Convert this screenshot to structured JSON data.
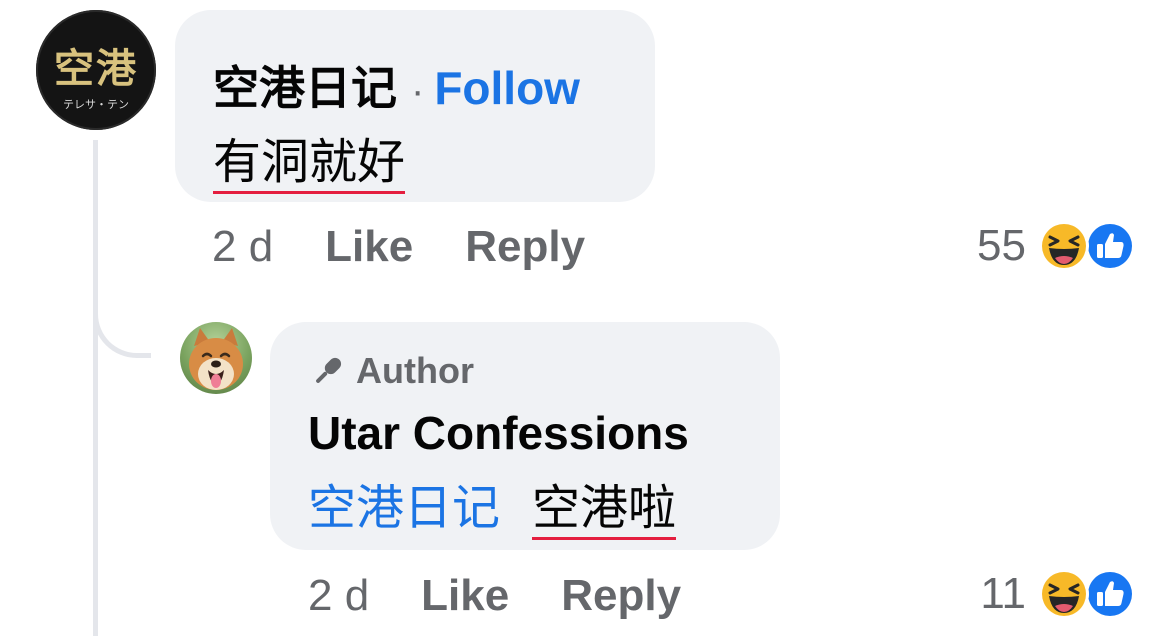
{
  "comment": {
    "avatar_text": "空港",
    "avatar_subtext": "テレサ・テン",
    "author": "空港日记",
    "separator": "·",
    "follow_label": "Follow",
    "text": "有洞就好",
    "timestamp": "2 d",
    "like_label": "Like",
    "reply_label": "Reply",
    "reaction_count": "55",
    "reaction_icons": [
      "haha-icon",
      "like-icon"
    ]
  },
  "reply": {
    "badge_icon": "microphone-icon",
    "badge_label": "Author",
    "author": "Utar Confessions",
    "mention": "空港日记",
    "text": "空港啦",
    "timestamp": "2 d",
    "like_label": "Like",
    "reply_label": "Reply",
    "reaction_count": "11",
    "reaction_icons": [
      "haha-icon",
      "like-icon"
    ]
  },
  "colors": {
    "link_blue": "#1b74e4",
    "bubble_gray": "#f0f2f5",
    "secondary_text": "#65676b",
    "spellcheck_red": "#e41e3f",
    "haha_yellow": "#f7b928",
    "like_blue": "#1877f2"
  }
}
